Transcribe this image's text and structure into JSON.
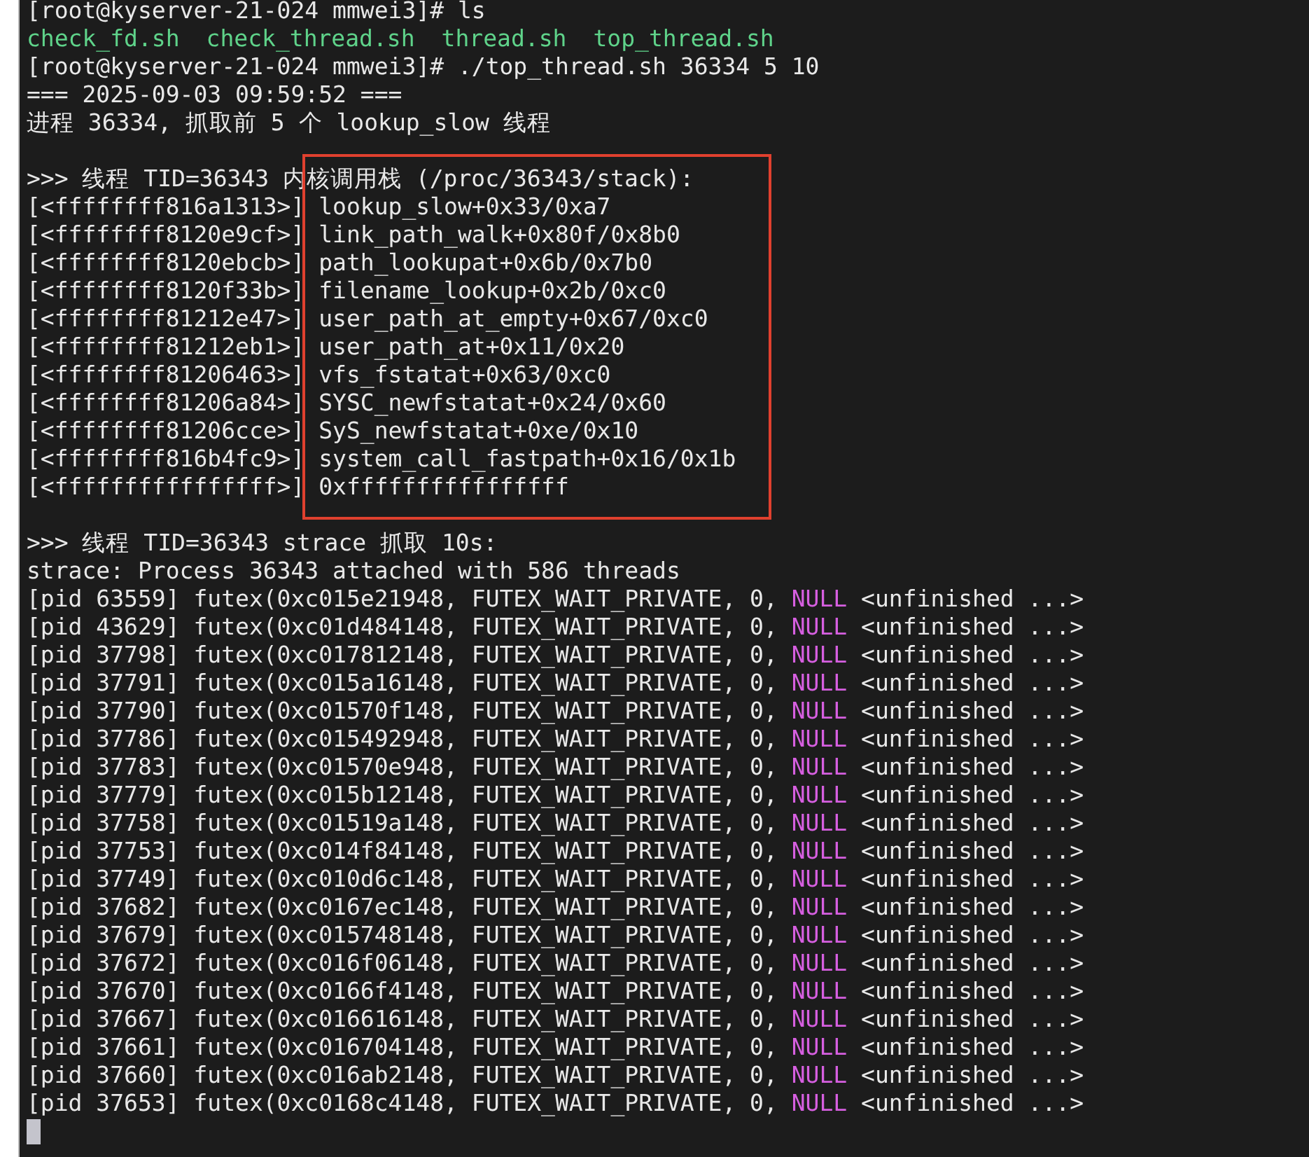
{
  "terminal": {
    "lines": [
      {
        "kind": "text",
        "text": "[root@kyserver-21-024 mmwei3]# ls"
      },
      {
        "kind": "files",
        "items": [
          "check_fd.sh",
          "check_thread.sh",
          "thread.sh",
          "top_thread.sh"
        ]
      },
      {
        "kind": "text",
        "text": "[root@kyserver-21-024 mmwei3]# ./top_thread.sh 36334 5 10"
      },
      {
        "kind": "text",
        "text": "=== 2025-09-03 09:59:52 ==="
      },
      {
        "kind": "text",
        "text": "进程 36334, 抓取前 5 个 lookup_slow 线程"
      },
      {
        "kind": "text",
        "text": ">>> 线程 TID=36343 内核调用栈 (/proc/36343/stack):",
        "blank_before": true
      },
      {
        "kind": "stack",
        "address": "[<ffffffff816a1313>]",
        "symbol": "lookup_slow+0x33/0xa7"
      },
      {
        "kind": "stack",
        "address": "[<ffffffff8120e9cf>]",
        "symbol": "link_path_walk+0x80f/0x8b0"
      },
      {
        "kind": "stack",
        "address": "[<ffffffff8120ebcb>]",
        "symbol": "path_lookupat+0x6b/0x7b0"
      },
      {
        "kind": "stack",
        "address": "[<ffffffff8120f33b>]",
        "symbol": "filename_lookup+0x2b/0xc0"
      },
      {
        "kind": "stack",
        "address": "[<ffffffff81212e47>]",
        "symbol": "user_path_at_empty+0x67/0xc0"
      },
      {
        "kind": "stack",
        "address": "[<ffffffff81212eb1>]",
        "symbol": "user_path_at+0x11/0x20"
      },
      {
        "kind": "stack",
        "address": "[<ffffffff81206463>]",
        "symbol": "vfs_fstatat+0x63/0xc0"
      },
      {
        "kind": "stack",
        "address": "[<ffffffff81206a84>]",
        "symbol": "SYSC_newfstatat+0x24/0x60"
      },
      {
        "kind": "stack",
        "address": "[<ffffffff81206cce>]",
        "symbol": "SyS_newfstatat+0xe/0x10"
      },
      {
        "kind": "stack",
        "address": "[<ffffffff816b4fc9>]",
        "symbol": "system_call_fastpath+0x16/0x1b"
      },
      {
        "kind": "stack",
        "address": "[<ffffffffffffffff>]",
        "symbol": "0xffffffffffffffff"
      },
      {
        "kind": "text",
        "text": ">>> 线程 TID=36343 strace 抓取 10s:",
        "blank_before": true
      },
      {
        "kind": "text",
        "text": "strace: Process 36343 attached with 586 threads"
      },
      {
        "kind": "strace",
        "before": "[pid 63559] futex(0xc015e21948, FUTEX_WAIT_PRIVATE, 0, ",
        "keyword": "NULL",
        "after": " <unfinished ...>"
      },
      {
        "kind": "strace",
        "before": "[pid 43629] futex(0xc01d484148, FUTEX_WAIT_PRIVATE, 0, ",
        "keyword": "NULL",
        "after": " <unfinished ...>"
      },
      {
        "kind": "strace",
        "before": "[pid 37798] futex(0xc017812148, FUTEX_WAIT_PRIVATE, 0, ",
        "keyword": "NULL",
        "after": " <unfinished ...>"
      },
      {
        "kind": "strace",
        "before": "[pid 37791] futex(0xc015a16148, FUTEX_WAIT_PRIVATE, 0, ",
        "keyword": "NULL",
        "after": " <unfinished ...>"
      },
      {
        "kind": "strace",
        "before": "[pid 37790] futex(0xc01570f148, FUTEX_WAIT_PRIVATE, 0, ",
        "keyword": "NULL",
        "after": " <unfinished ...>"
      },
      {
        "kind": "strace",
        "before": "[pid 37786] futex(0xc015492948, FUTEX_WAIT_PRIVATE, 0, ",
        "keyword": "NULL",
        "after": " <unfinished ...>"
      },
      {
        "kind": "strace",
        "before": "[pid 37783] futex(0xc01570e948, FUTEX_WAIT_PRIVATE, 0, ",
        "keyword": "NULL",
        "after": " <unfinished ...>"
      },
      {
        "kind": "strace",
        "before": "[pid 37779] futex(0xc015b12148, FUTEX_WAIT_PRIVATE, 0, ",
        "keyword": "NULL",
        "after": " <unfinished ...>"
      },
      {
        "kind": "strace",
        "before": "[pid 37758] futex(0xc01519a148, FUTEX_WAIT_PRIVATE, 0, ",
        "keyword": "NULL",
        "after": " <unfinished ...>"
      },
      {
        "kind": "strace",
        "before": "[pid 37753] futex(0xc014f84148, FUTEX_WAIT_PRIVATE, 0, ",
        "keyword": "NULL",
        "after": " <unfinished ...>"
      },
      {
        "kind": "strace",
        "before": "[pid 37749] futex(0xc010d6c148, FUTEX_WAIT_PRIVATE, 0, ",
        "keyword": "NULL",
        "after": " <unfinished ...>"
      },
      {
        "kind": "strace",
        "before": "[pid 37682] futex(0xc0167ec148, FUTEX_WAIT_PRIVATE, 0, ",
        "keyword": "NULL",
        "after": " <unfinished ...>"
      },
      {
        "kind": "strace",
        "before": "[pid 37679] futex(0xc015748148, FUTEX_WAIT_PRIVATE, 0, ",
        "keyword": "NULL",
        "after": " <unfinished ...>"
      },
      {
        "kind": "strace",
        "before": "[pid 37672] futex(0xc016f06148, FUTEX_WAIT_PRIVATE, 0, ",
        "keyword": "NULL",
        "after": " <unfinished ...>"
      },
      {
        "kind": "strace",
        "before": "[pid 37670] futex(0xc0166f4148, FUTEX_WAIT_PRIVATE, 0, ",
        "keyword": "NULL",
        "after": " <unfinished ...>"
      },
      {
        "kind": "strace",
        "before": "[pid 37667] futex(0xc016616148, FUTEX_WAIT_PRIVATE, 0, ",
        "keyword": "NULL",
        "after": " <unfinished ...>"
      },
      {
        "kind": "strace",
        "before": "[pid 37661] futex(0xc016704148, FUTEX_WAIT_PRIVATE, 0, ",
        "keyword": "NULL",
        "after": " <unfinished ...>"
      },
      {
        "kind": "strace",
        "before": "[pid 37660] futex(0xc016ab2148, FUTEX_WAIT_PRIVATE, 0, ",
        "keyword": "NULL",
        "after": " <unfinished ...>"
      },
      {
        "kind": "strace",
        "before": "[pid 37653] futex(0xc0168c4148, FUTEX_WAIT_PRIVATE, 0, ",
        "keyword": "NULL",
        "after": " <unfinished ...>"
      }
    ]
  }
}
